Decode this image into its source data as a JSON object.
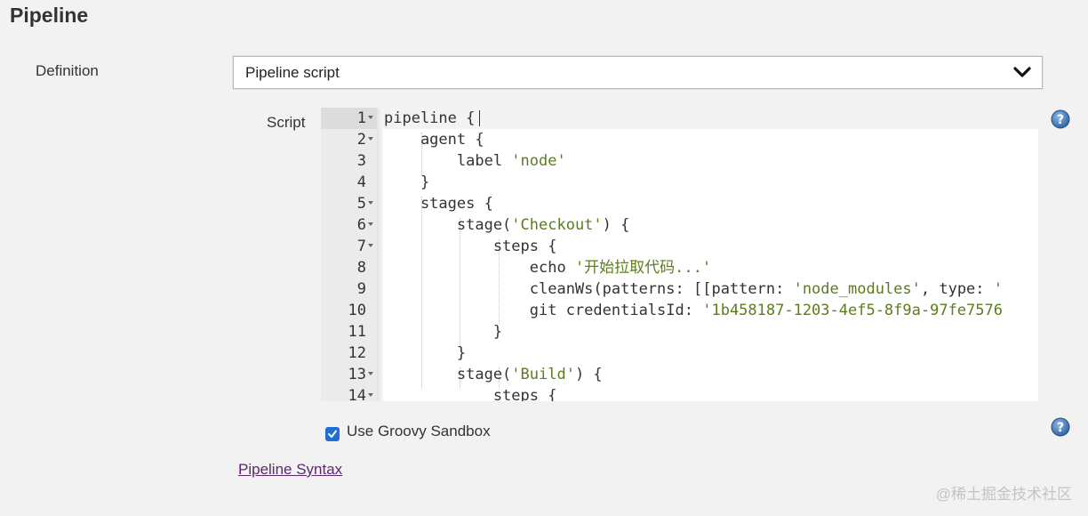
{
  "section": {
    "title": "Pipeline"
  },
  "definition": {
    "label": "Definition",
    "selected": "Pipeline script"
  },
  "script": {
    "label": "Script",
    "lines": [
      {
        "num": "1",
        "fold": true,
        "parts": [
          {
            "t": "pipeline {",
            "s": false
          }
        ]
      },
      {
        "num": "2",
        "fold": true,
        "parts": [
          {
            "t": "    agent {",
            "s": false
          }
        ]
      },
      {
        "num": "3",
        "fold": false,
        "parts": [
          {
            "t": "        label ",
            "s": false
          },
          {
            "t": "'node'",
            "s": true
          }
        ]
      },
      {
        "num": "4",
        "fold": false,
        "parts": [
          {
            "t": "    }",
            "s": false
          }
        ]
      },
      {
        "num": "5",
        "fold": true,
        "parts": [
          {
            "t": "    stages {",
            "s": false
          }
        ]
      },
      {
        "num": "6",
        "fold": true,
        "parts": [
          {
            "t": "        stage(",
            "s": false
          },
          {
            "t": "'Checkout'",
            "s": true
          },
          {
            "t": ") {",
            "s": false
          }
        ]
      },
      {
        "num": "7",
        "fold": true,
        "parts": [
          {
            "t": "            steps {",
            "s": false
          }
        ]
      },
      {
        "num": "8",
        "fold": false,
        "parts": [
          {
            "t": "                echo ",
            "s": false
          },
          {
            "t": "'开始拉取代码...'",
            "s": true
          }
        ]
      },
      {
        "num": "9",
        "fold": false,
        "parts": [
          {
            "t": "                cleanWs(patterns: [[pattern: ",
            "s": false
          },
          {
            "t": "'node_modules'",
            "s": true
          },
          {
            "t": ", type: ",
            "s": false
          },
          {
            "t": "'",
            "s": true
          }
        ]
      },
      {
        "num": "10",
        "fold": false,
        "parts": [
          {
            "t": "                git credentialsId: ",
            "s": false
          },
          {
            "t": "'1b458187-1203-4ef5-8f9a-97fe7576",
            "s": true
          }
        ]
      },
      {
        "num": "11",
        "fold": false,
        "parts": [
          {
            "t": "            }",
            "s": false
          }
        ]
      },
      {
        "num": "12",
        "fold": false,
        "parts": [
          {
            "t": "        }",
            "s": false
          }
        ]
      },
      {
        "num": "13",
        "fold": true,
        "parts": [
          {
            "t": "        stage(",
            "s": false
          },
          {
            "t": "'Build'",
            "s": true
          },
          {
            "t": ") {",
            "s": false
          }
        ]
      },
      {
        "num": "14",
        "fold": true,
        "parts": [
          {
            "t": "            steps {",
            "s": false
          }
        ]
      }
    ]
  },
  "sandbox": {
    "label": "Use Groovy Sandbox",
    "checked": true
  },
  "links": {
    "syntax": "Pipeline Syntax"
  },
  "watermark": "@稀土掘金技术社区",
  "icons": {
    "help": "help-icon",
    "dropdown": "chevron-down-icon",
    "check": "check-icon"
  },
  "colors": {
    "string": "#5c7d1b",
    "link": "#5b2a6b",
    "checkbox": "#1f6fd1"
  }
}
